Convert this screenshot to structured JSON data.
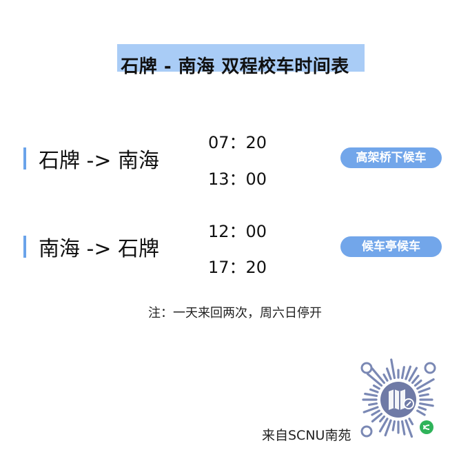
{
  "title": "石牌 - 南海 双程校车时间表",
  "routes": [
    {
      "name": "石牌 -> 南海",
      "times": [
        "07：20",
        "13：00"
      ],
      "stop": "高架桥下候车"
    },
    {
      "name": "南海 -> 石牌",
      "times": [
        "12：00",
        "17：20"
      ],
      "stop": "候车亭候车"
    }
  ],
  "note": "注：一天来回两次，周六日停开",
  "footer": "来自SCNU南苑",
  "colors": {
    "accent": "#72a6ea",
    "title_highlight": "#a9ccf6",
    "qr_dots": "#7a88b4",
    "qr_center": "#6f7aa6",
    "wechat_green": "#2fb35a"
  },
  "icons": {
    "qr_code": "mini-program-code-icon",
    "wechat": "wechat-icon"
  }
}
